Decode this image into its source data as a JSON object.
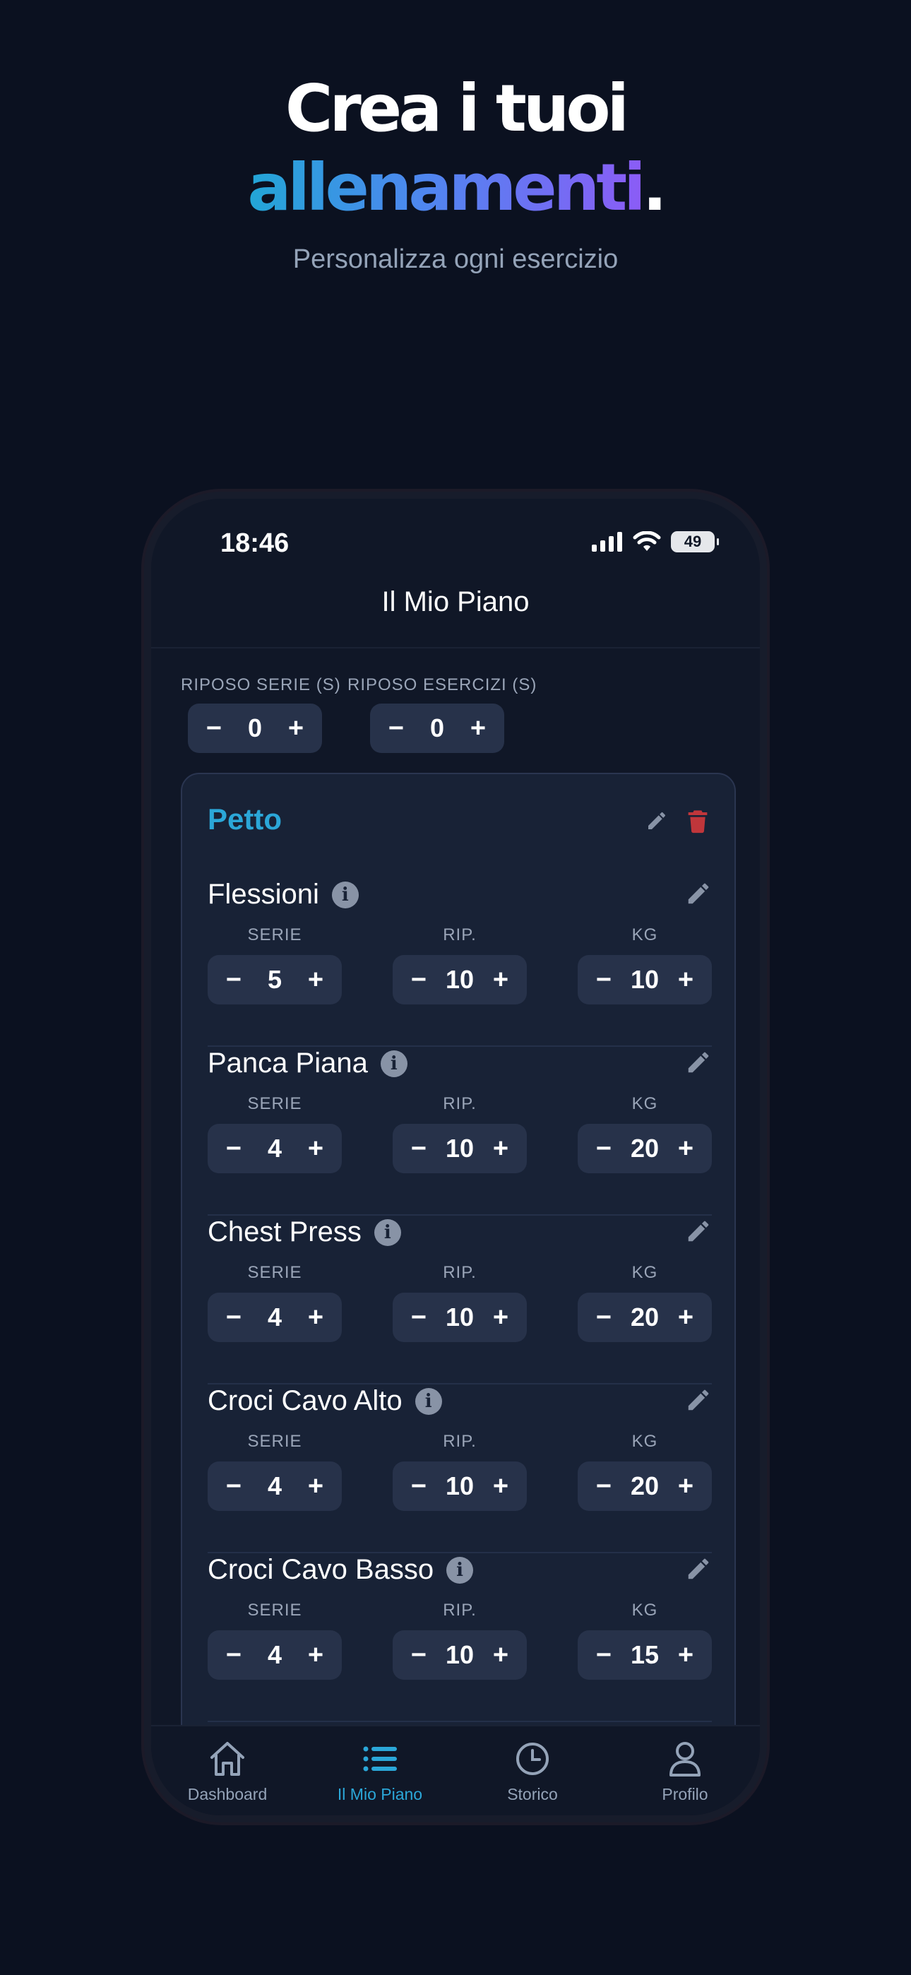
{
  "hero": {
    "line1": "Crea i tuoi",
    "line2": "allenamenti",
    "line2_dot": ".",
    "subtitle": "Personalizza ogni esercizio"
  },
  "status_bar": {
    "time": "18:46",
    "battery": "49"
  },
  "header": {
    "title": "Il Mio Piano"
  },
  "rest": {
    "series_label": "RIPOSO SERIE (S)",
    "series_value": "0",
    "exercises_label": "RIPOSO ESERCIZI (S)",
    "exercises_value": "0"
  },
  "stepper": {
    "minus": "−",
    "plus": "+"
  },
  "group": {
    "title": "Petto",
    "columns": {
      "sets": "SERIE",
      "reps": "RIP.",
      "kg": "KG"
    },
    "exercises": [
      {
        "name": "Flessioni",
        "sets": "5",
        "reps": "10",
        "kg": "10"
      },
      {
        "name": "Panca Piana",
        "sets": "4",
        "reps": "10",
        "kg": "20"
      },
      {
        "name": "Chest Press",
        "sets": "4",
        "reps": "10",
        "kg": "20"
      },
      {
        "name": "Croci Cavo Alto",
        "sets": "4",
        "reps": "10",
        "kg": "20"
      },
      {
        "name": "Croci Cavo Basso",
        "sets": "4",
        "reps": "10",
        "kg": "15"
      }
    ]
  },
  "tabs": [
    {
      "label": "Dashboard",
      "icon": "home-icon"
    },
    {
      "label": "Il Mio Piano",
      "icon": "list-icon",
      "active": true
    },
    {
      "label": "Storico",
      "icon": "clock-icon"
    },
    {
      "label": "Profilo",
      "icon": "user-icon"
    }
  ],
  "colors": {
    "background": "#0b1120",
    "accent": "#2ba7d8",
    "delete": "#c0363b",
    "card": "#182236"
  }
}
